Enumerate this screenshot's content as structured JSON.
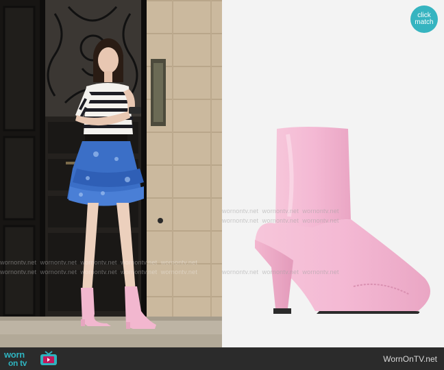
{
  "badge": {
    "line1": "click",
    "line2": "match"
  },
  "footer": {
    "site": "WornOnTV.net",
    "logo_top": "worn",
    "logo_bottom": "on tv"
  },
  "watermark": {
    "text": "wornontv.net"
  },
  "icons": {
    "tv": "tv-icon",
    "badge": "click-to-match-badge"
  },
  "colors": {
    "accent": "#36b4c0",
    "boot": "#f4b9d4",
    "bar": "#2b2b2b"
  }
}
